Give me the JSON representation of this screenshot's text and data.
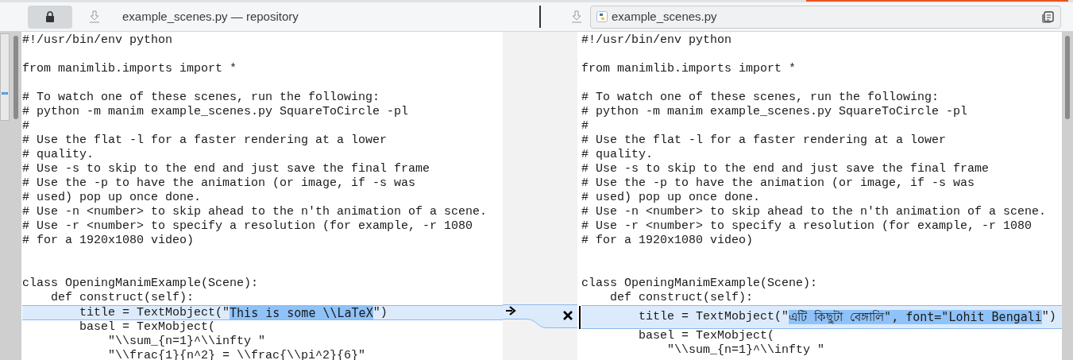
{
  "header": {
    "lock_button": {
      "pressed": true
    },
    "left_title": "example_scenes.py — repository",
    "right_file": "example_scenes.py"
  },
  "panes": [
    {
      "lines": [
        {
          "text": "#!/usr/bin/env python",
          "changed": false
        },
        {
          "changed": false
        },
        {
          "text": "from manimlib.imports import *",
          "changed": false
        },
        {
          "changed": false
        },
        {
          "text": "# To watch one of these scenes, run the following:",
          "changed": false
        },
        {
          "text": "# python -m manim example_scenes.py SquareToCircle -pl",
          "changed": false
        },
        {
          "text": "#",
          "changed": false
        },
        {
          "text": "# Use the flat -l for a faster rendering at a lower",
          "changed": false
        },
        {
          "text": "# quality.",
          "changed": false
        },
        {
          "text": "# Use -s to skip to the end and just save the final frame",
          "changed": false
        },
        {
          "text": "# Use the -p to have the animation (or image, if -s was",
          "changed": false
        },
        {
          "text": "# used) pop up once done.",
          "changed": false
        },
        {
          "text": "# Use -n <number> to skip ahead to the n'th animation of a scene.",
          "changed": false
        },
        {
          "text": "# Use -r <number> to specify a resolution (for example, -r 1080",
          "changed": false
        },
        {
          "text": "# for a 1920x1080 video)",
          "changed": false
        },
        {
          "changed": false
        },
        {
          "changed": false
        },
        {
          "text": "class OpeningManimExample(Scene):",
          "changed": false
        },
        {
          "text": "    def construct(self):",
          "changed": false
        },
        {
          "changed": true,
          "segments": [
            {
              "text": "        title = TextMobject(\"",
              "highlighted": false
            },
            {
              "text": "This is some \\\\LaTeX",
              "highlighted": true
            },
            {
              "text": "\")",
              "highlighted": false
            }
          ]
        },
        {
          "text": "        basel = TexMobject(",
          "changed": false
        },
        {
          "text": "            \"\\\\sum_{n=1}^\\\\infty \"",
          "changed": false
        },
        {
          "text": "            \"\\\\frac{1}{n^2} = \\\\frac{\\\\pi^2}{6}\"",
          "changed": false
        }
      ]
    },
    {
      "lines": [
        {
          "text": "#!/usr/bin/env python",
          "changed": false
        },
        {
          "changed": false
        },
        {
          "text": "from manimlib.imports import *",
          "changed": false
        },
        {
          "changed": false
        },
        {
          "text": "# To watch one of these scenes, run the following:",
          "changed": false
        },
        {
          "text": "# python -m manim example_scenes.py SquareToCircle -pl",
          "changed": false
        },
        {
          "text": "#",
          "changed": false
        },
        {
          "text": "# Use the flat -l for a faster rendering at a lower",
          "changed": false
        },
        {
          "text": "# quality.",
          "changed": false
        },
        {
          "text": "# Use -s to skip to the end and just save the final frame",
          "changed": false
        },
        {
          "text": "# Use the -p to have the animation (or image, if -s was",
          "changed": false
        },
        {
          "text": "# used) pop up once done.",
          "changed": false
        },
        {
          "text": "# Use -n <number> to skip ahead to the n'th animation of a scene.",
          "changed": false
        },
        {
          "text": "# Use -r <number> to specify a resolution (for example, -r 1080",
          "changed": false
        },
        {
          "text": "# for a 1920x1080 video)",
          "changed": false
        },
        {
          "changed": false
        },
        {
          "changed": false
        },
        {
          "text": "class OpeningManimExample(Scene):",
          "changed": false
        },
        {
          "text": "    def construct(self):",
          "changed": false
        },
        {
          "changed": true,
          "segments": [
            {
              "text": "        title = TextMobject(\"",
              "highlighted": false
            },
            {
              "text": "এটি কিছুটা বেঙ্গালি\", font=\"Lohit Bengali",
              "highlighted": true
            },
            {
              "text": "\")",
              "highlighted": false
            }
          ]
        },
        {
          "text": "        basel = TexMobject(",
          "changed": false
        },
        {
          "text": "            \"\\\\sum_{n=1}^\\\\infty \"",
          "changed": false
        }
      ]
    }
  ]
}
